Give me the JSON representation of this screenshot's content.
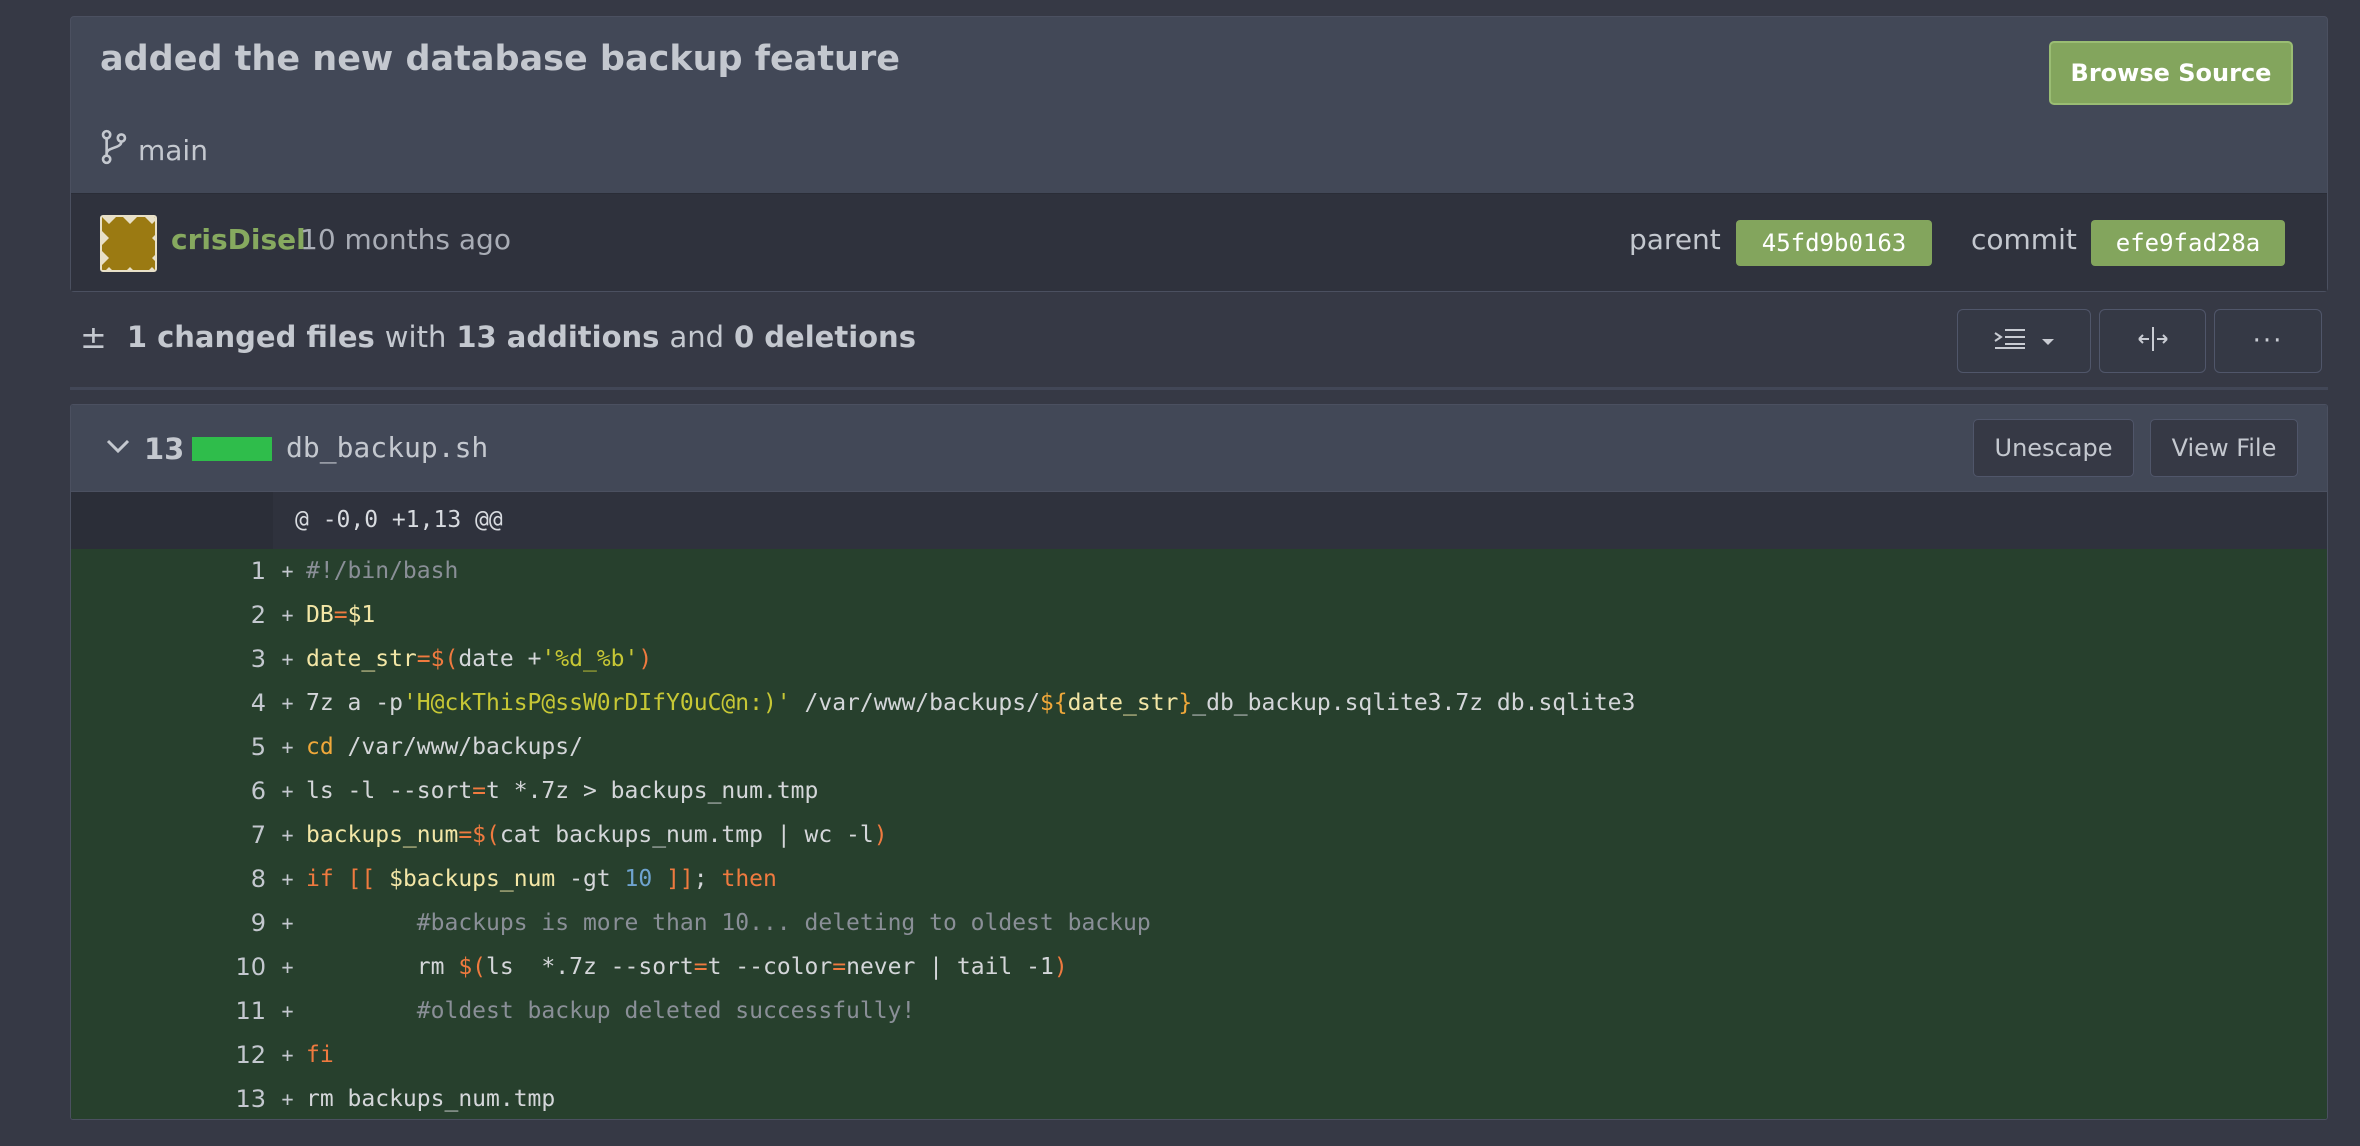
{
  "commit": {
    "title": "added the new database backup feature",
    "branch": "main",
    "browse_source_label": "Browse Source",
    "author": "crisDisel",
    "time": "10 months ago",
    "parent_label": "parent",
    "parent_sha": "45fd9b0163",
    "commit_label": "commit",
    "commit_sha": "efe9fad28a"
  },
  "stats": {
    "changed_files": "1 changed files",
    "with": "with",
    "additions": "13 additions",
    "and": "and",
    "deletions": "0 deletions"
  },
  "toolbar": {
    "more_label": "···"
  },
  "file": {
    "count": "13",
    "name": "db_backup.sh",
    "unescape_label": "Unescape",
    "view_file_label": "View File",
    "hunk_header": "@ -0,0 +1,13 @@",
    "plus_sign": "+",
    "lines": [
      {
        "n": "1",
        "tokens": [
          {
            "t": "#!/bin/bash",
            "c": "com"
          }
        ]
      },
      {
        "n": "2",
        "tokens": [
          {
            "t": "DB",
            "c": "var"
          },
          {
            "t": "=",
            "c": "op"
          },
          {
            "t": "$1",
            "c": "var"
          }
        ]
      },
      {
        "n": "3",
        "tokens": [
          {
            "t": "date_str",
            "c": "var"
          },
          {
            "t": "=$(",
            "c": "op"
          },
          {
            "t": "date +",
            "c": ""
          },
          {
            "t": "'%d_%b'",
            "c": "str"
          },
          {
            "t": ")",
            "c": "op"
          }
        ]
      },
      {
        "n": "4",
        "tokens": [
          {
            "t": "7z a -p",
            "c": ""
          },
          {
            "t": "'H@ckThisP@ssW0rDIfY0uC@n:)'",
            "c": "str"
          },
          {
            "t": " /var/www/backups/",
            "c": ""
          },
          {
            "t": "${",
            "c": "bi"
          },
          {
            "t": "date_str",
            "c": "var"
          },
          {
            "t": "}",
            "c": "bi"
          },
          {
            "t": "_db_backup.sqlite3.7z db.sqlite3",
            "c": ""
          }
        ]
      },
      {
        "n": "5",
        "tokens": [
          {
            "t": "cd",
            "c": "bi"
          },
          {
            "t": " /var/www/backups/",
            "c": ""
          }
        ]
      },
      {
        "n": "6",
        "tokens": [
          {
            "t": "ls -l --sort",
            "c": ""
          },
          {
            "t": "=",
            "c": "op"
          },
          {
            "t": "t *.7z > backups_num.tmp",
            "c": ""
          }
        ]
      },
      {
        "n": "7",
        "tokens": [
          {
            "t": "backups_num",
            "c": "var"
          },
          {
            "t": "=$(",
            "c": "op"
          },
          {
            "t": "cat backups_num.tmp | wc -l",
            "c": ""
          },
          {
            "t": ")",
            "c": "op"
          }
        ]
      },
      {
        "n": "8",
        "tokens": [
          {
            "t": "if",
            "c": "kw"
          },
          {
            "t": " [[ ",
            "c": "op"
          },
          {
            "t": "$backups_num",
            "c": "var"
          },
          {
            "t": " -gt ",
            "c": ""
          },
          {
            "t": "10",
            "c": "num"
          },
          {
            "t": " ]]",
            "c": "op"
          },
          {
            "t": "; ",
            "c": ""
          },
          {
            "t": "then",
            "c": "kw"
          }
        ]
      },
      {
        "n": "9",
        "tokens": [
          {
            "t": "        ",
            "c": ""
          },
          {
            "t": "#backups is more than 10... deleting to oldest backup",
            "c": "com"
          }
        ]
      },
      {
        "n": "10",
        "tokens": [
          {
            "t": "        rm ",
            "c": ""
          },
          {
            "t": "$(",
            "c": "op"
          },
          {
            "t": "ls  *.7z --sort",
            "c": ""
          },
          {
            "t": "=",
            "c": "op"
          },
          {
            "t": "t --color",
            "c": ""
          },
          {
            "t": "=",
            "c": "op"
          },
          {
            "t": "never | tail -1",
            "c": ""
          },
          {
            "t": ")",
            "c": "op"
          }
        ]
      },
      {
        "n": "11",
        "tokens": [
          {
            "t": "        ",
            "c": ""
          },
          {
            "t": "#oldest backup deleted successfully!",
            "c": "com"
          }
        ]
      },
      {
        "n": "12",
        "tokens": [
          {
            "t": "fi",
            "c": "kw"
          }
        ]
      },
      {
        "n": "13",
        "tokens": [
          {
            "t": "rm backups_num.tmp",
            "c": ""
          }
        ]
      }
    ]
  },
  "colors": {
    "accent_green": "#83a55d",
    "addition_bg": "#27402d",
    "addition_bar": "#2fbd4b"
  }
}
